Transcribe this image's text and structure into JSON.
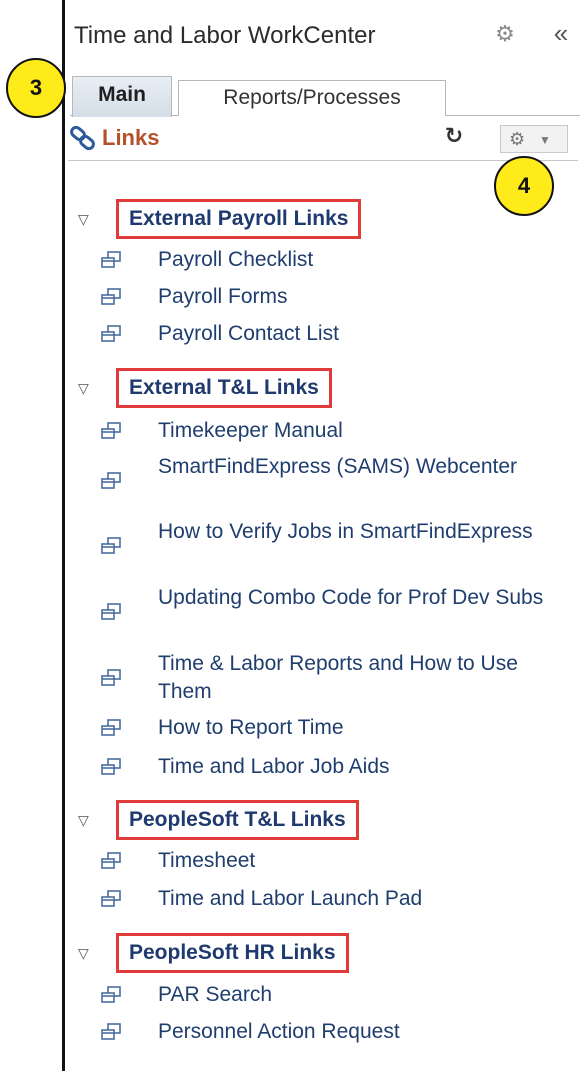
{
  "header": {
    "title": "Time and Labor WorkCenter",
    "settings_icon": "gear-icon",
    "collapse_icon": "double-chevron-left-icon"
  },
  "tabs": [
    {
      "label": "Main",
      "active": true
    },
    {
      "label": "Reports/Processes",
      "active": false
    }
  ],
  "pagelet": {
    "title": "Links",
    "icon": "links-icon",
    "refresh_icon": "refresh-icon",
    "options_icon": "gear-dropdown-icon",
    "accent": "#b4512a"
  },
  "callouts": {
    "tabs": "3",
    "groups": "4"
  },
  "groups": [
    {
      "title": "External Payroll Links",
      "items": [
        "Payroll Checklist",
        "Payroll Forms",
        "Payroll Contact List"
      ]
    },
    {
      "title": "External T&L Links",
      "items": [
        "Timekeeper Manual",
        "SmartFindExpress (SAMS) Webcenter",
        "How to Verify Jobs in SmartFindExpress",
        "Updating Combo Code for Prof Dev Subs",
        "Time & Labor Reports and How to Use Them",
        "How to Report Time",
        "Time and Labor Job Aids"
      ]
    },
    {
      "title": "PeopleSoft T&L Links",
      "items": [
        "Timesheet",
        "Time and Labor Launch Pad"
      ]
    },
    {
      "title": "PeopleSoft HR Links",
      "items": [
        "PAR Search",
        "Personnel Action Request"
      ]
    }
  ],
  "colors": {
    "highlight_border": "#e03a3a",
    "group_title": "#1e3a6e",
    "link_text": "#1f3e6e",
    "callout_fill": "#ffeb1a"
  }
}
